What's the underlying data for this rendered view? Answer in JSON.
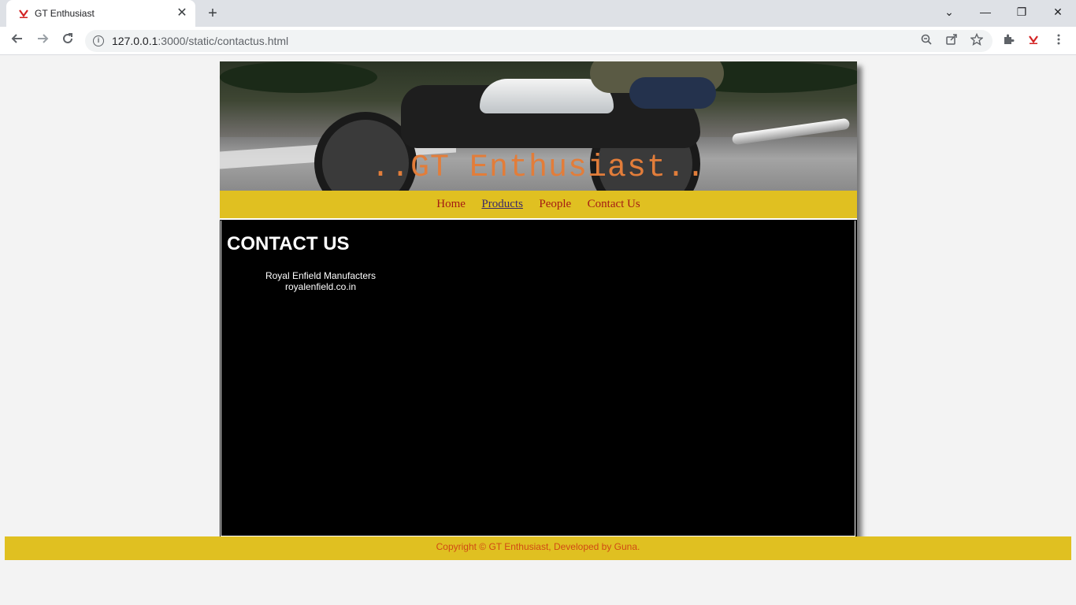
{
  "browser": {
    "tab_title": "GT Enthusiast",
    "tab_close": "✕",
    "new_tab": "+",
    "url_host": "127.0.0.1",
    "url_rest": ":3000/static/contactus.html",
    "window_controls": {
      "dropdown": "⌄",
      "minimize": "—",
      "restore": "❐",
      "close": "✕"
    },
    "toolbar_icons": [
      "back-arrow-icon",
      "forward-arrow-icon",
      "reload-icon",
      "info-icon",
      "zoom-icon",
      "share-icon",
      "star-icon",
      "extensions-icon",
      "profile-extension-icon",
      "menu-icon"
    ]
  },
  "page": {
    "banner_title": "..GT Enthusiast..",
    "nav": {
      "home": "Home",
      "products": "Products",
      "people": "People",
      "contact": "Contact Us"
    },
    "heading": "CONTACT US",
    "address": {
      "line1": "Royal Enfield Manufacters",
      "line2": "royalenfield.co.in"
    },
    "footer": "Copyright © GT Enthusiast, Developed by Guna."
  },
  "colors": {
    "nav_bg": "#e0c021",
    "banner_title": "#e27d3a",
    "nav_link": "#a41b14",
    "footer_text": "#d04a14",
    "content_bg": "#000000"
  }
}
